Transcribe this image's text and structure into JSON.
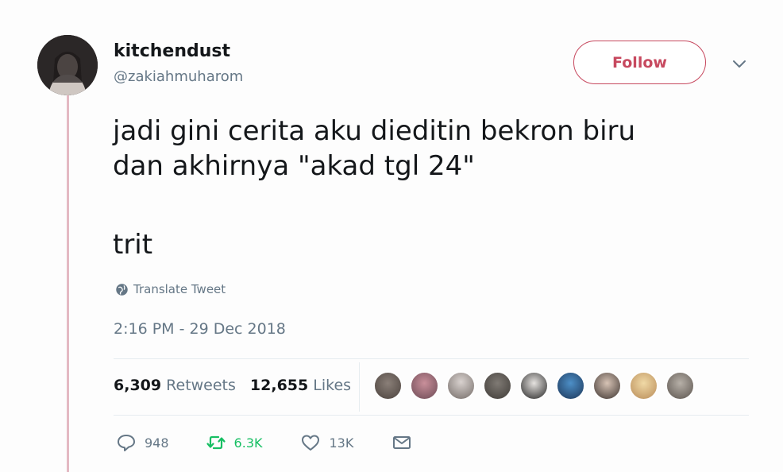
{
  "user": {
    "display_name": "kitchendust",
    "handle": "@zakiahmuharom"
  },
  "follow_label": "Follow",
  "tweet": {
    "lines": [
      "jadi gini cerita aku dieditin bekron biru",
      "dan akhirnya \"akad tgl 24\""
    ],
    "trailing": "trit"
  },
  "translate_label": "Translate Tweet",
  "timestamp": "2:16 PM - 29 Dec 2018",
  "stats": {
    "retweets_count": "6,309",
    "retweets_label": "Retweets",
    "likes_count": "12,655",
    "likes_label": "Likes"
  },
  "actions": {
    "replies": "948",
    "retweets": "6.3K",
    "likes": "13K"
  },
  "icons": {
    "avatar": "avatar",
    "chevron": "chevron-down-icon",
    "globe": "globe-icon",
    "reply": "reply-icon",
    "retweet": "retweet-icon",
    "like": "heart-icon",
    "dm": "envelope-icon"
  },
  "colors": {
    "accent": "#c7495f",
    "retweet_green": "#17bf63",
    "muted": "#657786"
  }
}
